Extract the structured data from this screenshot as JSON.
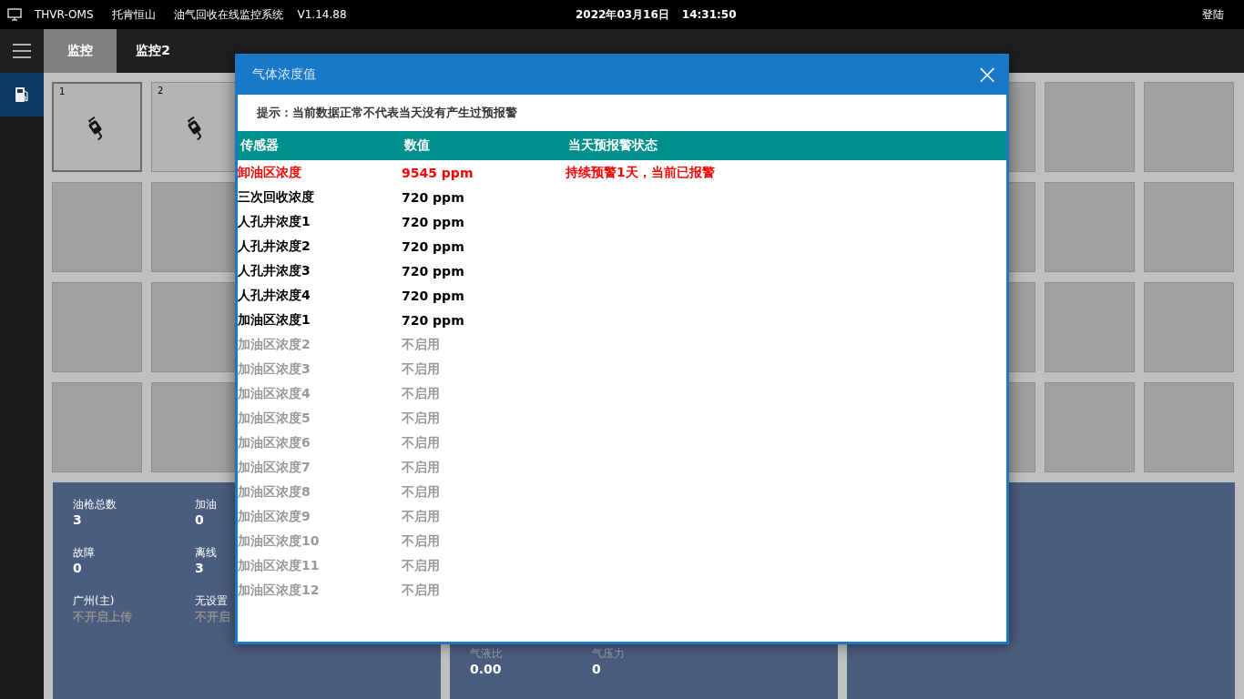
{
  "top_bar": {
    "app_code": "THVR-OMS",
    "company": "托肯恒山",
    "system_name": "油气回收在线监控系统",
    "version": "V1.14.88",
    "date": "2022年03月16日",
    "time": "14:31:50",
    "login": "登陆"
  },
  "tabs": [
    {
      "label": "监控",
      "selected": true
    },
    {
      "label": "监控2",
      "selected": false
    }
  ],
  "sidebar": {
    "items": [
      {
        "kind": "fuel",
        "selected": true
      }
    ]
  },
  "tile_rows": [
    {
      "tiles": [
        {
          "kind": "nozzle",
          "number": "1",
          "selected": true
        },
        {
          "kind": "nozzle",
          "number": "2",
          "selected": false
        },
        {
          "kind": "empty",
          "selected": false
        },
        {
          "kind": "empty",
          "selected": false
        },
        {
          "kind": "empty",
          "selected": false
        }
      ]
    },
    {
      "tiles": [
        {
          "kind": "empty",
          "selected": false
        },
        {
          "kind": "empty",
          "selected": false
        },
        {
          "kind": "empty",
          "selected": false
        },
        {
          "kind": "empty",
          "selected": false
        },
        {
          "kind": "empty",
          "selected": false
        }
      ]
    },
    {
      "tiles": [
        {
          "kind": "empty",
          "selected": false
        },
        {
          "kind": "empty",
          "selected": false
        },
        {
          "kind": "empty",
          "selected": false
        },
        {
          "kind": "empty",
          "selected": false
        },
        {
          "kind": "empty",
          "selected": false
        }
      ]
    },
    {
      "tiles": [
        {
          "kind": "empty",
          "selected": false
        },
        {
          "kind": "empty",
          "selected": false
        },
        {
          "kind": "empty",
          "selected": false
        },
        {
          "kind": "empty",
          "selected": false
        },
        {
          "kind": "empty",
          "selected": false
        }
      ]
    }
  ],
  "panels": [
    {
      "stats": [
        {
          "label": "油枪总数",
          "value": "3",
          "kind": "count"
        },
        {
          "label": "加油",
          "value": "0",
          "kind": "count"
        },
        {
          "label": "故障",
          "value": "0",
          "kind": "count"
        },
        {
          "label": "离线",
          "value": "3",
          "kind": "count"
        },
        {
          "label": "广州(主)",
          "value": "不开启上传",
          "kind": "upload"
        },
        {
          "label": "无设置",
          "value": "不开启",
          "kind": "upload"
        }
      ]
    },
    {
      "stats": [
        {
          "label": "气液比",
          "value": "0.00",
          "kind": "measure"
        },
        {
          "label": "气压力",
          "value": "0",
          "kind": "measure"
        }
      ]
    }
  ],
  "dialog": {
    "title": "气体浓度值",
    "close": "×",
    "hint": "提示：当前数据正常不代表当天没有产生过预报警",
    "columns": [
      "传感器",
      "数值",
      "当天预报警状态"
    ],
    "rows": [
      {
        "sensor": "卸油区浓度",
        "value": "9545 ppm",
        "status": "持续预警1天，当前已报警",
        "kind": "alarm"
      },
      {
        "sensor": "三次回收浓度",
        "value": "720 ppm",
        "kind": "normal"
      },
      {
        "sensor": "人孔井浓度1",
        "value": "720 ppm",
        "kind": "normal"
      },
      {
        "sensor": "人孔井浓度2",
        "value": "720 ppm",
        "kind": "normal"
      },
      {
        "sensor": "人孔井浓度3",
        "value": "720 ppm",
        "kind": "normal"
      },
      {
        "sensor": "人孔井浓度4",
        "value": "720 ppm",
        "kind": "normal"
      },
      {
        "sensor": "加油区浓度1",
        "value": "720 ppm",
        "kind": "normal"
      },
      {
        "sensor": "加油区浓度2",
        "value": "不启用",
        "kind": "disabled"
      },
      {
        "sensor": "加油区浓度3",
        "value": "不启用",
        "kind": "disabled"
      },
      {
        "sensor": "加油区浓度4",
        "value": "不启用",
        "kind": "disabled"
      },
      {
        "sensor": "加油区浓度5",
        "value": "不启用",
        "kind": "disabled"
      },
      {
        "sensor": "加油区浓度6",
        "value": "不启用",
        "kind": "disabled"
      },
      {
        "sensor": "加油区浓度7",
        "value": "不启用",
        "kind": "disabled"
      },
      {
        "sensor": "加油区浓度8",
        "value": "不启用",
        "kind": "disabled"
      },
      {
        "sensor": "加油区浓度9",
        "value": "不启用",
        "kind": "disabled"
      },
      {
        "sensor": "加油区浓度10",
        "value": "不启用",
        "kind": "disabled"
      },
      {
        "sensor": "加油区浓度11",
        "value": "不启用",
        "kind": "disabled"
      },
      {
        "sensor": "加油区浓度12",
        "value": "不启用",
        "kind": "disabled"
      }
    ]
  }
}
